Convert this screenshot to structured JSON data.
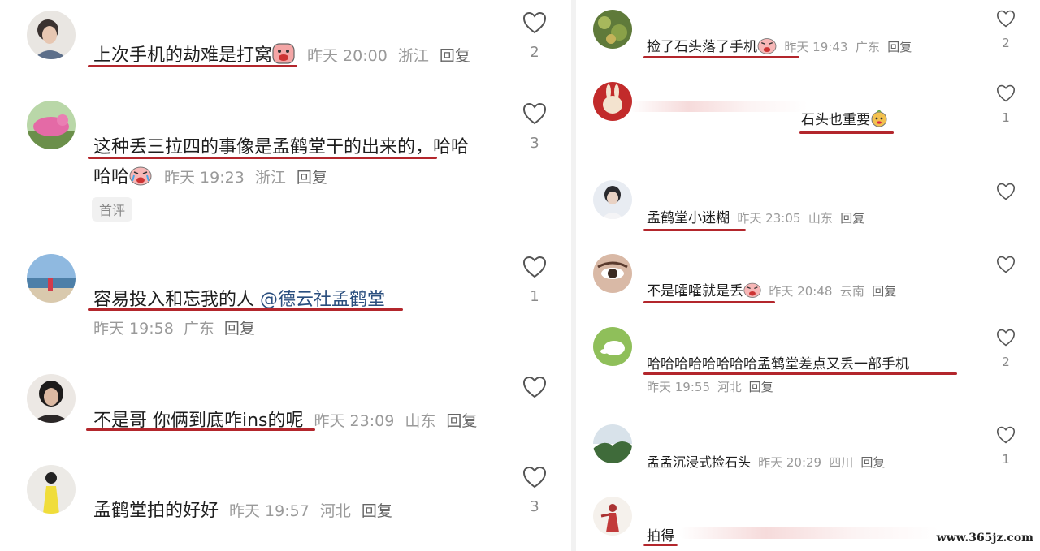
{
  "left_comments": [
    {
      "text": "上次手机的劫难是打窝",
      "time": "昨天 20:00",
      "region": "浙江",
      "reply": "回复",
      "likes": "2"
    },
    {
      "text_line1": "这种丢三拉四的事像是孟鹤堂干的出来的，哈哈",
      "text_line2": "哈哈",
      "time": "昨天 19:23",
      "region": "浙江",
      "reply": "回复",
      "likes": "3",
      "badge": "首评"
    },
    {
      "text": "容易投入和忘我的人 ",
      "mention": "@德云社孟鹤堂",
      "time": "昨天 19:58",
      "region": "广东",
      "reply": "回复",
      "likes": "1"
    },
    {
      "text": "不是哥 你俩到底咋ins的呢",
      "time": "昨天 23:09",
      "region": "山东",
      "reply": "回复",
      "likes": ""
    },
    {
      "text": "孟鹤堂拍的好好",
      "time": "昨天 19:57",
      "region": "河北",
      "reply": "回复",
      "likes": "3"
    }
  ],
  "right_comments": [
    {
      "text": "捡了石头落了手机",
      "time": "昨天 19:43",
      "region": "广东",
      "reply": "回复",
      "likes": "2"
    },
    {
      "text": "石头也重要",
      "likes": "1"
    },
    {
      "text": "孟鹤堂小迷糊",
      "time": "昨天 23:05",
      "region": "山东",
      "reply": "回复",
      "likes": ""
    },
    {
      "text": "不是嚯嚯就是丢",
      "time": "昨天 20:48",
      "region": "云南",
      "reply": "回复",
      "likes": ""
    },
    {
      "text": "哈哈哈哈哈哈哈哈孟鹤堂差点又丢一部手机",
      "time": "昨天 19:55",
      "region": "河北",
      "reply": "回复",
      "likes": "2"
    },
    {
      "text": "孟孟沉浸式捡石头",
      "time": "昨天 20:29",
      "region": "四川",
      "reply": "回复",
      "likes": "1"
    },
    {
      "text": "拍得",
      "likes": ""
    }
  ],
  "watermark": "www.365jz.com",
  "colors": {
    "underline": "#b3262c",
    "meta": "#9a9a9a",
    "mention": "#2a4e7e"
  }
}
